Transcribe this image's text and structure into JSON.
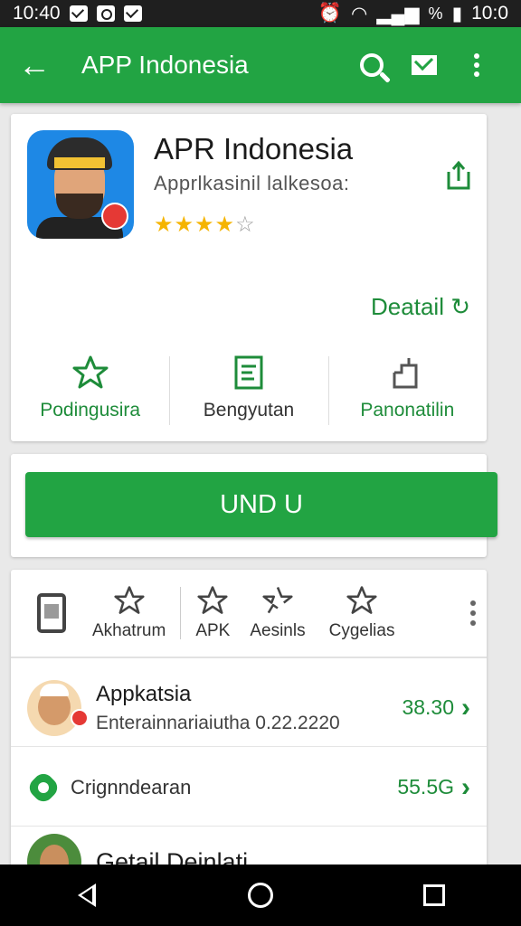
{
  "status_bar": {
    "time_left": "10:40",
    "time_right": "10:0",
    "battery": "%"
  },
  "app_bar": {
    "title": "APP Indonesia",
    "back_icon": "arrow-left",
    "actions": [
      "search-icon",
      "mail-icon",
      "more-vert-icon"
    ]
  },
  "app": {
    "name": "APR Indonesia",
    "subtitle": "Apprlkasinil lalkesoa:",
    "rating_stars": 4,
    "rating_max": 5,
    "detail_link": "Deatail"
  },
  "action_buttons": [
    {
      "label": "Podingusira",
      "icon": "star-outline-icon"
    },
    {
      "label": "Bengyutan",
      "icon": "document-icon"
    },
    {
      "label": "Panonatilin",
      "icon": "device-icon"
    }
  ],
  "install": {
    "label": "UND U"
  },
  "categories": [
    {
      "label": "Akhatrum",
      "icon": "star-outline-icon"
    },
    {
      "label": "APK",
      "icon": "star-outline-icon"
    },
    {
      "label": "Aesinls",
      "icon": "star-broken-icon"
    },
    {
      "label": "Cygelias",
      "icon": "star-outline-icon"
    }
  ],
  "list": [
    {
      "title": "Appkatsia",
      "subtitle": "Enterainnariaiutha 0.22.2220",
      "size": "38.30"
    },
    {
      "title": "Crignndearan",
      "size": "55.5G"
    },
    {
      "title": "Getail Deinlati"
    }
  ],
  "colors": {
    "accent": "#22a443",
    "accent_text": "#1e8c3a",
    "star": "#f5b400"
  }
}
